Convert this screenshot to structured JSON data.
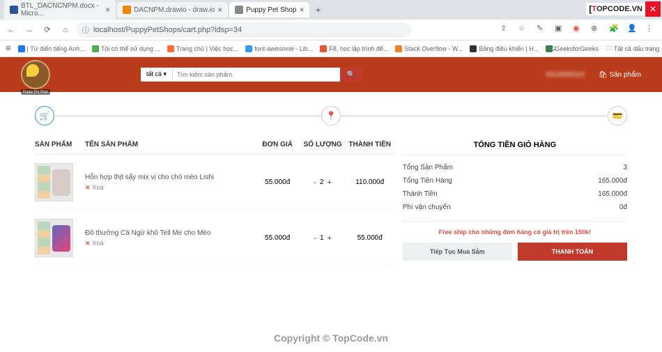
{
  "browser": {
    "tabs": [
      {
        "title": "BTL_DACNCNPM.docx - Micro...",
        "icon": "#2b579a"
      },
      {
        "title": "DACNPM.drawio - draw.io",
        "icon": "#f08705"
      },
      {
        "title": "Puppy Pet Shop",
        "icon": "#888",
        "active": true
      }
    ],
    "url": "localhost/PuppyPetShops/cart.php?idsp=34",
    "bookmarks": [
      {
        "label": "| Từ điển tiếng Anh...",
        "icon": "#1877f2"
      },
      {
        "label": "Tôi có thể sử dụng ...",
        "icon": "#4caf50"
      },
      {
        "label": "Trang chủ | Việc học...",
        "icon": "#ff6b35"
      },
      {
        "label": "font-awesome - Lib...",
        "icon": "#339af0"
      },
      {
        "label": "F8, học lập trình để...",
        "icon": "#f05123"
      },
      {
        "label": "Stack Overflow - W...",
        "icon": "#f48024"
      },
      {
        "label": "Bảng điều khiển | H...",
        "icon": "#333"
      },
      {
        "label": "GeeksforGeeks",
        "icon": "#2f8d46"
      },
      {
        "label": "Tất cả dấu trang",
        "icon": "#5f6368"
      }
    ]
  },
  "header": {
    "logo_label": "Puppy Pet Shop",
    "search_cat": "tất cả",
    "search_placeholder": "Tìm kiếm sản phẩm",
    "phone": "0918985020",
    "nav_product": "Sản phẩm"
  },
  "steps": {
    "icons": [
      "🛒",
      "📍",
      "💳"
    ]
  },
  "cart": {
    "headers": {
      "product": "SẢN PHẨM",
      "name": "TÊN SẢN PHẨM",
      "price": "ĐƠN GIÁ",
      "qty": "SỐ LƯỢNG",
      "total": "THÀNH TIỀN"
    },
    "items": [
      {
        "name": "Hỗn hợp thịt sấy mix vị cho chó mèo Lishi",
        "price": "55.000đ",
        "qty": "2",
        "total": "110.000đ"
      },
      {
        "name": "Đồ thưởng Cá Ngừ khô Tell Me cho Mèo",
        "price": "55.000đ",
        "qty": "1",
        "total": "55.000đ"
      }
    ],
    "delete_label": "Xoá"
  },
  "summary": {
    "title": "TỔNG TIỀN GIỎ HÀNG",
    "rows": [
      {
        "label": "Tổng Sản Phẩm",
        "value": "3"
      },
      {
        "label": "Tổng Tiền Hàng",
        "value": "165.000đ"
      },
      {
        "label": "Thành Tiền",
        "value": "165.000đ"
      },
      {
        "label": "Phí vận chuyển",
        "value": "0đ"
      }
    ],
    "free_ship": "Free ship cho những đơn hàng có giá trị trên 150k!",
    "btn_continue": "Tiếp Tục Mua Sắm",
    "btn_checkout": "THANH TOÁN"
  },
  "watermark": {
    "logo_t": "T",
    "logo_rest": "OPCODE.VN",
    "url": "TopCode.vn",
    "copyright": "Copyright © TopCode.vn"
  }
}
